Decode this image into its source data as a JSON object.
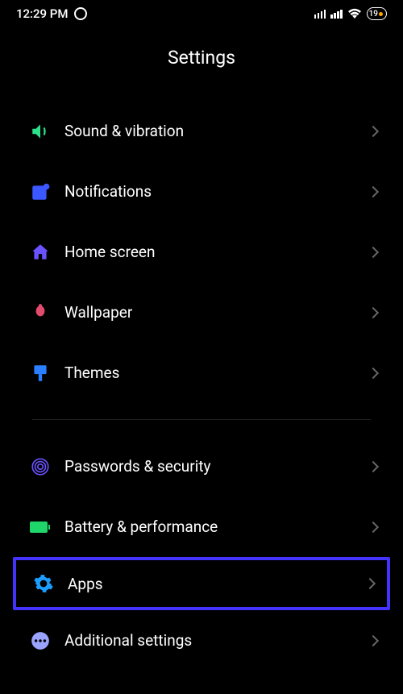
{
  "status": {
    "time": "12:29 PM",
    "battery_pct": "19"
  },
  "title": "Settings",
  "groups": [
    {
      "items": [
        {
          "id": "sound",
          "label": "Sound & vibration"
        },
        {
          "id": "notifications",
          "label": "Notifications"
        },
        {
          "id": "home",
          "label": "Home screen"
        },
        {
          "id": "wallpaper",
          "label": "Wallpaper"
        },
        {
          "id": "themes",
          "label": "Themes"
        }
      ]
    },
    {
      "items": [
        {
          "id": "security",
          "label": "Passwords & security"
        },
        {
          "id": "battery",
          "label": "Battery & performance"
        },
        {
          "id": "apps",
          "label": "Apps",
          "highlight": true
        },
        {
          "id": "additional",
          "label": "Additional settings"
        }
      ]
    }
  ]
}
